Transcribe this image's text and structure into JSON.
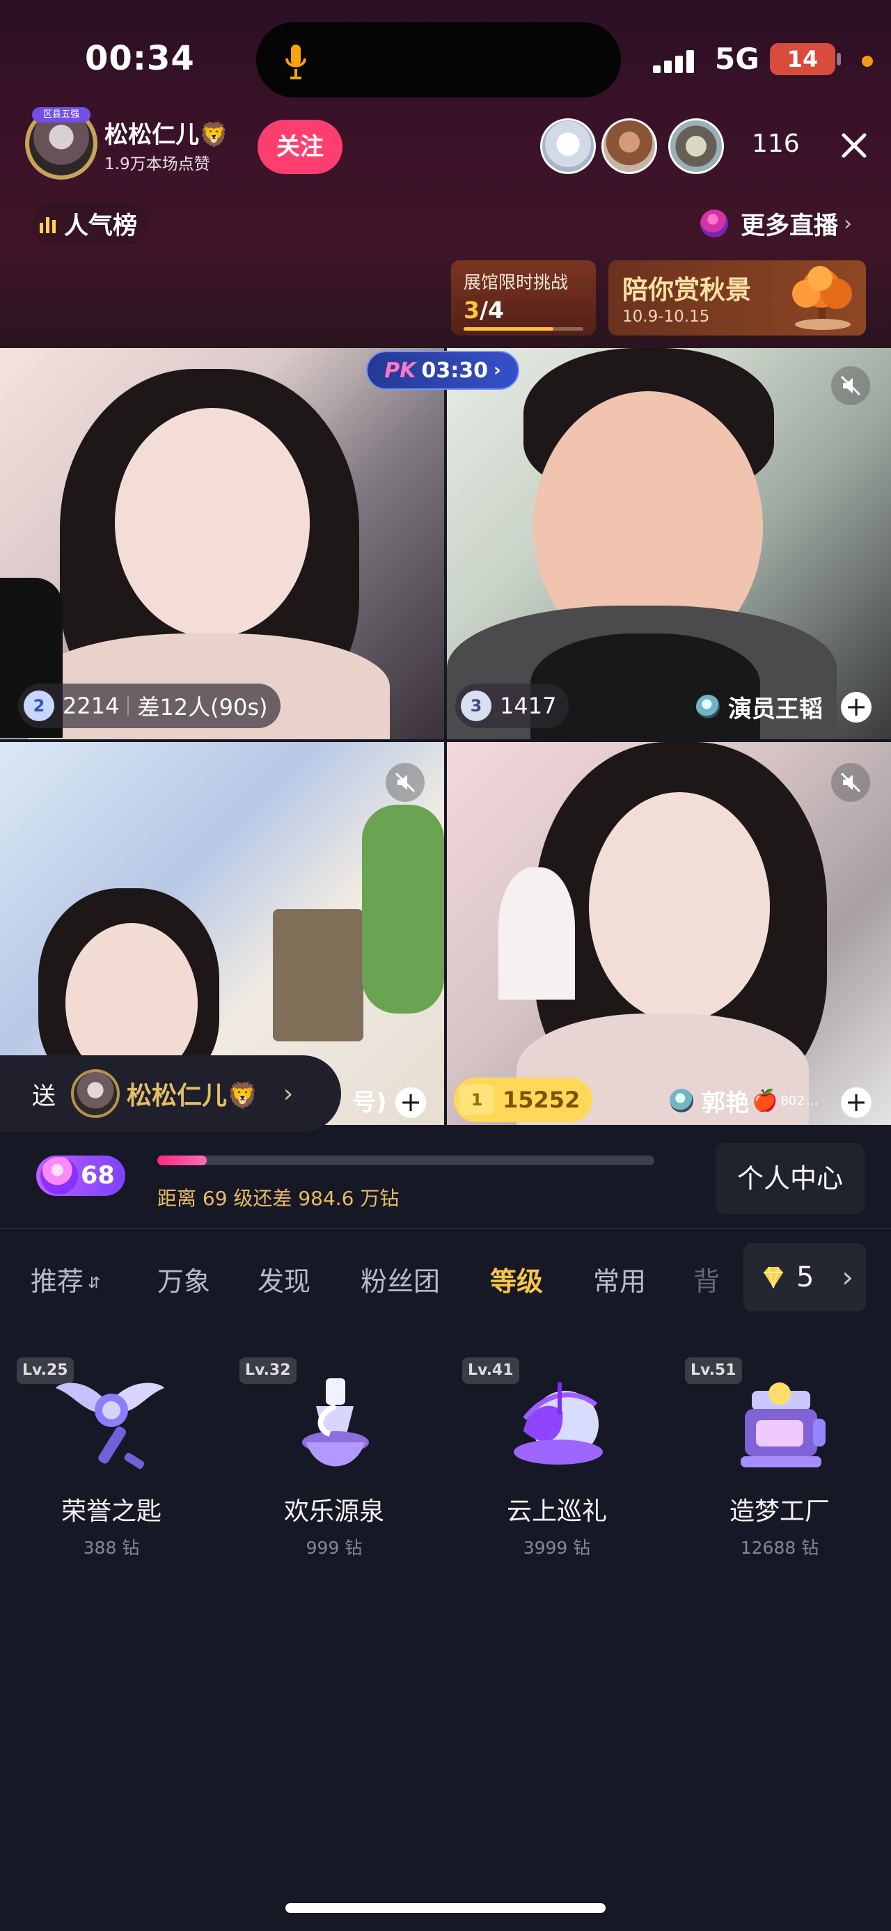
{
  "status_bar": {
    "time": "00:34",
    "network": "5G",
    "battery": "14",
    "icons": [
      "mic-icon",
      "signal-icon"
    ]
  },
  "header": {
    "host_name": "松松仁儿🦁",
    "host_likes": "1.9万本场点赞",
    "follow_label": "关注",
    "viewer_count": "116",
    "close_icon": "close-icon",
    "ranking_label": "人气榜",
    "more_live_label": "更多直播",
    "more_live_chevron": "›",
    "host_rank_label": "区县五强"
  },
  "promos": {
    "challenge_title": "展馆限时挑战",
    "challenge_current": "3",
    "challenge_total": "/4",
    "challenge_progress": 0.75,
    "autumn_title": "陪你赏秋景",
    "autumn_date": "10.9-10.15"
  },
  "pk": {
    "label": "PK",
    "time": "03:30",
    "chevron": "›"
  },
  "tiles": {
    "a": {
      "rank": "2",
      "score": "2214",
      "note": "差12人(90s)"
    },
    "b": {
      "rank": "3",
      "score": "1417",
      "name": "演员王韬",
      "plus": "+"
    },
    "c": {
      "truncated_name": "号)",
      "plus": "+"
    },
    "d": {
      "rank": "1",
      "score": "15252",
      "name": "郭艳",
      "emoji": "🍎",
      "extra": "802",
      "ellipsis": "…",
      "plus": "+"
    }
  },
  "gift_sender": {
    "send_label": "送",
    "recipient_name": "松松仁儿🦁",
    "arrow": "›"
  },
  "level": {
    "number": "68",
    "progress": 0.1,
    "hint": "距离 69 级还差 984.6 万钻",
    "personal_center": "个人中心"
  },
  "tabs": [
    {
      "label": "推荐"
    },
    {
      "label": "万象"
    },
    {
      "label": "发现"
    },
    {
      "label": "粉丝团"
    },
    {
      "label": "等级"
    },
    {
      "label": "常用"
    },
    {
      "label": "背"
    }
  ],
  "sort_icon": "⇵",
  "balance": {
    "number": "5",
    "chevron": "›"
  },
  "gifts": [
    {
      "level": "Lv.25",
      "name": "荣誉之匙",
      "price": "388 钻"
    },
    {
      "level": "Lv.32",
      "name": "欢乐源泉",
      "price": "999 钻"
    },
    {
      "level": "Lv.41",
      "name": "云上巡礼",
      "price": "3999 钻"
    },
    {
      "level": "Lv.51",
      "name": "造梦工厂",
      "price": "12688 钻"
    }
  ],
  "colors": {
    "accent_pink": "#ff3e70",
    "gold": "#e8bd63",
    "panel_bg": "#161826"
  }
}
